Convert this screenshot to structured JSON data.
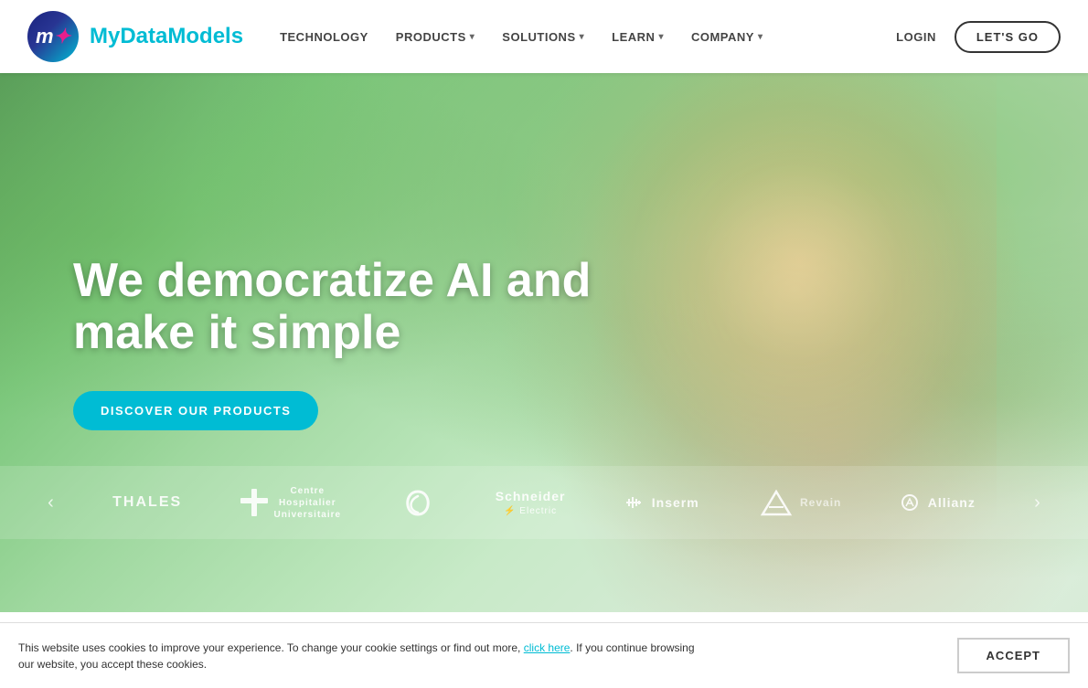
{
  "header": {
    "logo_text_my": "My",
    "logo_text_data": "Data",
    "logo_text_models": "Models",
    "nav": {
      "items": [
        {
          "label": "TECHNOLOGY",
          "has_dropdown": false
        },
        {
          "label": "PRODUCTS",
          "has_dropdown": true
        },
        {
          "label": "SOLUTIONS",
          "has_dropdown": true
        },
        {
          "label": "LEARN",
          "has_dropdown": true
        },
        {
          "label": "COMPANY",
          "has_dropdown": true
        }
      ]
    },
    "login_label": "LOGIN",
    "lets_go_label": "LET'S GO"
  },
  "hero": {
    "title": "We democratize AI and make it simple",
    "cta_label": "DISCOVER OUR PRODUCTS"
  },
  "logos_bar": {
    "prev_label": "‹",
    "next_label": "›",
    "logos": [
      {
        "name": "THALES"
      },
      {
        "name": "Centre\nHospitalier\nUniversitaire"
      },
      {
        "name": "⟳"
      },
      {
        "name": "Schneider\nElectric"
      },
      {
        "name": "Inserm"
      },
      {
        "name": ""
      },
      {
        "name": "Allianz"
      }
    ]
  },
  "cookie": {
    "text_part1": "This website uses cookies to improve your experience. To change your cookie settings or find out more, click here. If you continue browsing our website, you accept these cookies.",
    "link_text": "click here",
    "accept_label": "ACCEPT"
  }
}
